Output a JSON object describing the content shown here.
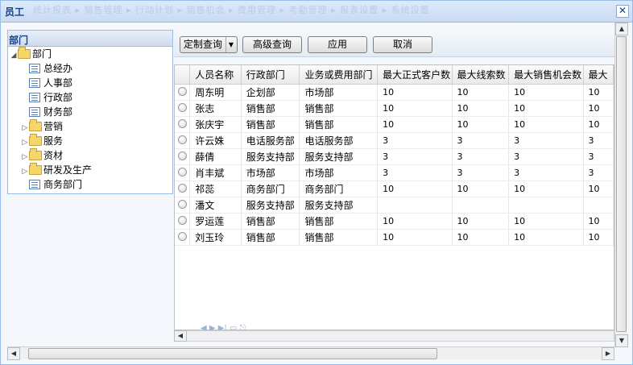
{
  "window": {
    "title": "员工",
    "close_glyph": "✕",
    "ghost_menu": "统计报表 ▸ 销售管理 ▸ 行动计划 ▸ 销售机会 ▸ 费用管理 ▸ 考勤管理 ▸ 报表设置 ▸ 系统设置"
  },
  "left_panel": {
    "header": "部门",
    "tree": [
      {
        "label": "部门",
        "type": "folder",
        "expanded": true,
        "level": 0
      },
      {
        "label": "总经办",
        "type": "leaf",
        "level": 1
      },
      {
        "label": "人事部",
        "type": "leaf",
        "level": 1
      },
      {
        "label": "行政部",
        "type": "leaf",
        "level": 1
      },
      {
        "label": "财务部",
        "type": "leaf",
        "level": 1
      },
      {
        "label": "营销",
        "type": "folder",
        "expanded": false,
        "level": 1
      },
      {
        "label": "服务",
        "type": "folder",
        "expanded": false,
        "level": 1
      },
      {
        "label": "资材",
        "type": "folder",
        "expanded": false,
        "level": 1
      },
      {
        "label": "研发及生产",
        "type": "folder",
        "expanded": false,
        "level": 1
      },
      {
        "label": "商务部门",
        "type": "leaf",
        "level": 1
      }
    ]
  },
  "toolbar": {
    "custom_query": "定制查询",
    "advanced_query": "高级查询",
    "apply": "应用",
    "cancel": "取消"
  },
  "grid": {
    "columns": [
      "人员名称",
      "行政部门",
      "业务或费用部门",
      "最大正式客户数",
      "最大线索数",
      "最大销售机会数",
      "最大"
    ],
    "rows": [
      [
        "周东明",
        "企划部",
        "市场部",
        "10",
        "10",
        "10",
        "10"
      ],
      [
        "张志",
        "销售部",
        "销售部",
        "10",
        "10",
        "10",
        "10"
      ],
      [
        "张庆宇",
        "销售部",
        "销售部",
        "10",
        "10",
        "10",
        "10"
      ],
      [
        "许云姝",
        "电话服务部",
        "电话服务部",
        "3",
        "3",
        "3",
        "3"
      ],
      [
        "薛倩",
        "服务支持部",
        "服务支持部",
        "3",
        "3",
        "3",
        "3"
      ],
      [
        "肖丰斌",
        "市场部",
        "市场部",
        "3",
        "3",
        "3",
        "3"
      ],
      [
        "祁蕊",
        "商务部门",
        "商务部门",
        "10",
        "10",
        "10",
        "10"
      ],
      [
        "潘文",
        "服务支持部",
        "服务支持部",
        "",
        "",
        "",
        ""
      ],
      [
        "罗运莲",
        "销售部",
        "销售部",
        "10",
        "10",
        "10",
        "10"
      ],
      [
        "刘玉玲",
        "销售部",
        "销售部",
        "10",
        "10",
        "10",
        "10"
      ]
    ]
  },
  "icons": {
    "tree_expanded": "◢",
    "tree_collapsed": "▷",
    "scroll_up": "▲",
    "scroll_down": "▼",
    "scroll_left": "◀",
    "scroll_right": "▶",
    "dropdown": "▼"
  },
  "colors": {
    "title_text": "#15428b",
    "border": "#99bbe8"
  }
}
